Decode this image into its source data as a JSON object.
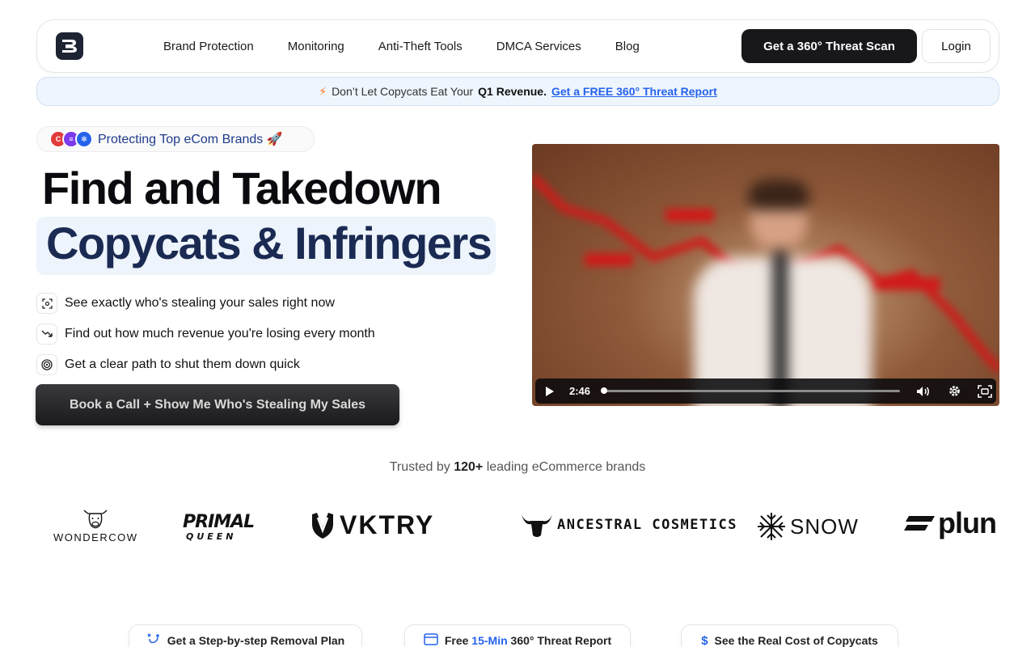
{
  "nav": {
    "links": [
      "Brand Protection",
      "Monitoring",
      "Anti-Theft Tools",
      "DMCA Services",
      "Blog"
    ],
    "cta_label": "Get a 360°  Threat Scan",
    "login_label": "Login"
  },
  "banner": {
    "prefix": "Don’t Let Copycats Eat Your",
    "bold": "Q1 Revenue.",
    "link": "Get a FREE 360° Threat Report"
  },
  "pill": {
    "text": "Protecting Top eCom Brands 🚀"
  },
  "hero": {
    "title_line1": "Find and Takedown",
    "title_line2": "Copycats & Infringers",
    "bullets": [
      "See exactly who's stealing your sales right now",
      "Find out how much revenue you're losing every month",
      "Get a clear path to shut them down quick"
    ],
    "cta_label": "Book a Call + Show Me Who's Stealing My Sales"
  },
  "video": {
    "time": "2:46",
    "progress": 0.0
  },
  "trusted": {
    "prefix": "Trusted by",
    "count": "120+",
    "suffix": "leading eCommerce brands"
  },
  "brands": [
    "WONDERCOW",
    "PRIMAL QUEEN",
    "VKTRY",
    "ANCESTRAL COSMETICS",
    "SNOW",
    "plun"
  ],
  "cards": [
    {
      "icon": "path-icon",
      "text": "Get a Step-by-step Removal Plan"
    },
    {
      "icon": "calendar-icon",
      "pre": "Free",
      "highlight": "15-Min",
      "post": "360° Threat Report"
    },
    {
      "icon": "dollar-icon",
      "text": "See the Real Cost of Copycats"
    }
  ]
}
